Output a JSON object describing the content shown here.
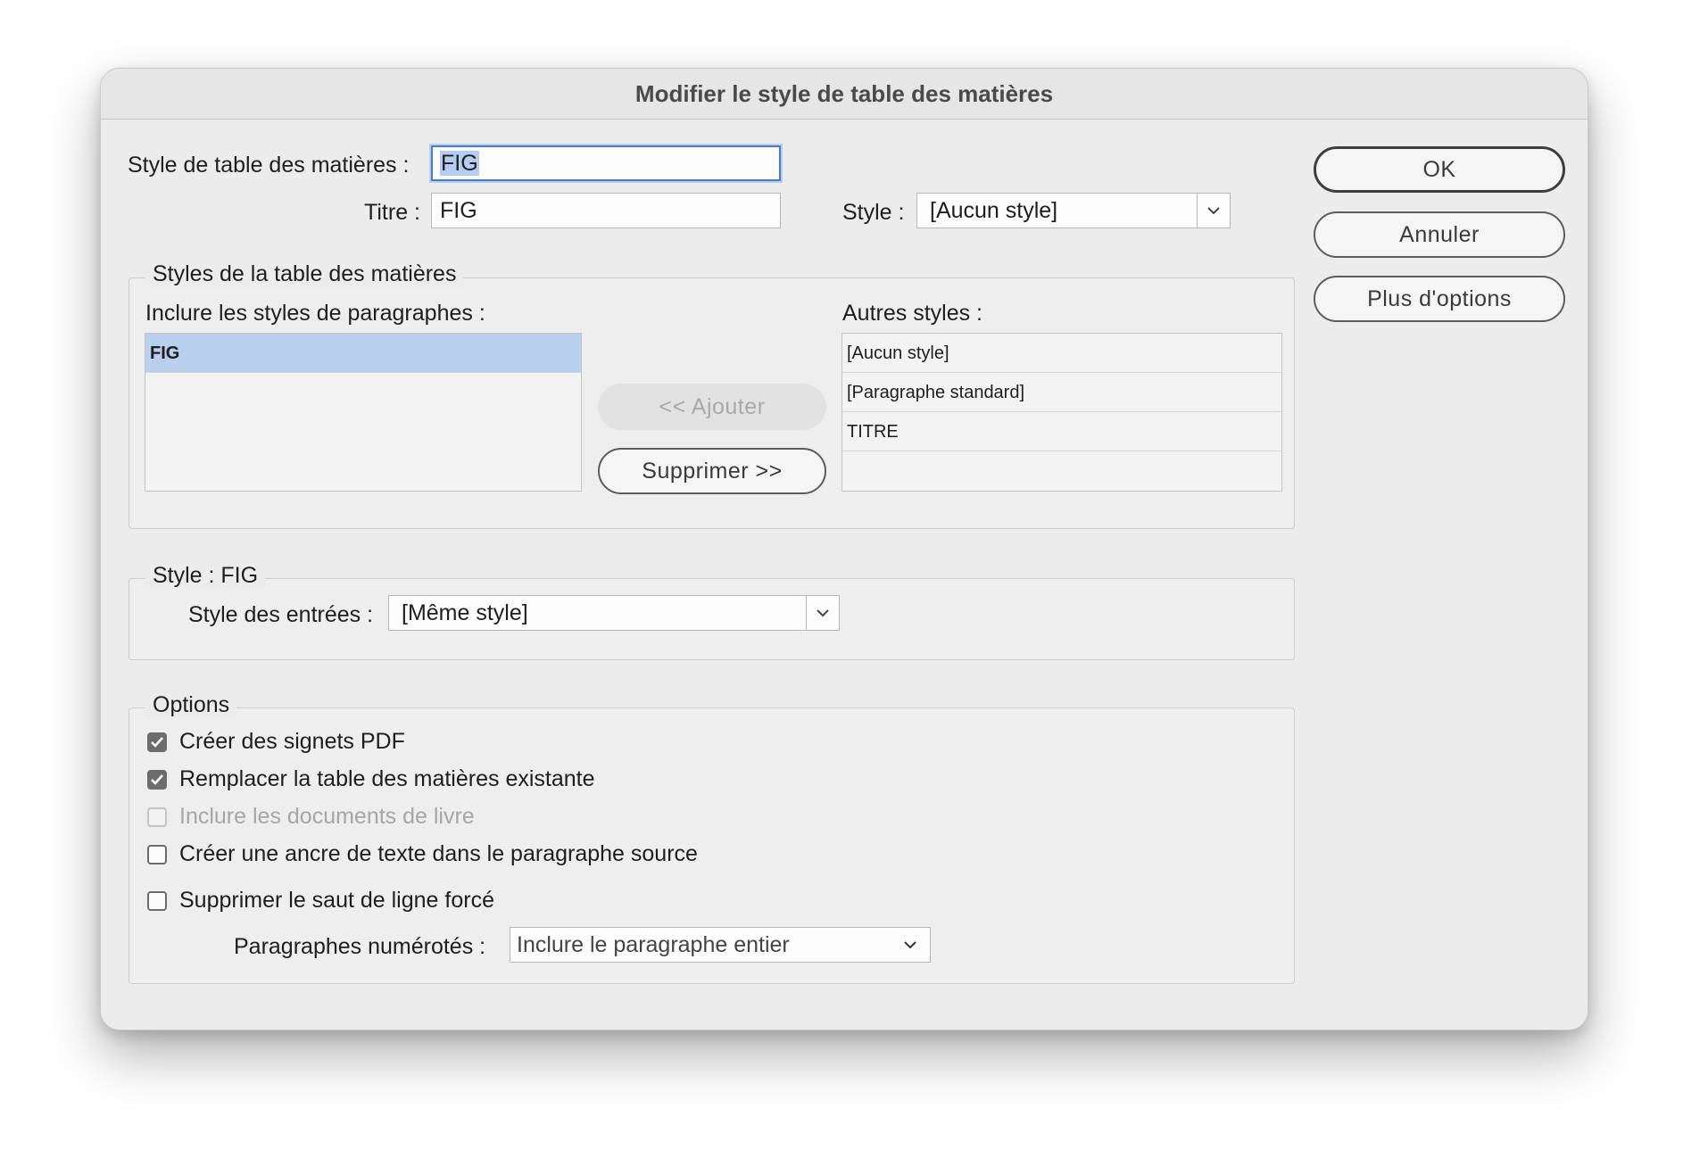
{
  "dialog": {
    "title": "Modifier le style de table des matières"
  },
  "top": {
    "toc_style_label": "Style de table des matières :",
    "toc_style_value": "FIG",
    "title_label": "Titre :",
    "title_value": "FIG",
    "style_label": "Style :",
    "style_value": "[Aucun style]"
  },
  "buttons": {
    "ok": "OK",
    "cancel": "Annuler",
    "more_options": "Plus d'options"
  },
  "toc_styles": {
    "legend": "Styles de la table des matières",
    "include_label": "Inclure les styles de paragraphes :",
    "included": [
      "FIG"
    ],
    "add_button": "<< Ajouter",
    "remove_button": "Supprimer >>",
    "other_label": "Autres styles :",
    "others": [
      "[Aucun style]",
      "[Paragraphe standard]",
      "TITRE"
    ]
  },
  "style_group": {
    "legend": "Style : FIG",
    "entry_style_label": "Style des entrées :",
    "entry_style_value": "[Même style]"
  },
  "options": {
    "legend": "Options",
    "items": [
      {
        "label": "Créer des signets PDF",
        "checked": true,
        "enabled": true
      },
      {
        "label": "Remplacer la table des matières existante",
        "checked": true,
        "enabled": true
      },
      {
        "label": "Inclure les documents de livre",
        "checked": false,
        "enabled": false
      },
      {
        "label": "Créer une ancre de texte dans le paragraphe source",
        "checked": false,
        "enabled": true
      },
      {
        "label": "Supprimer le saut de ligne forcé",
        "checked": false,
        "enabled": true
      }
    ],
    "numbered_label": "Paragraphes numérotés :",
    "numbered_value": "Inclure le paragraphe entier"
  },
  "icons": {
    "dropdown": "chevron-down-icon",
    "check": "checkmark-icon"
  }
}
